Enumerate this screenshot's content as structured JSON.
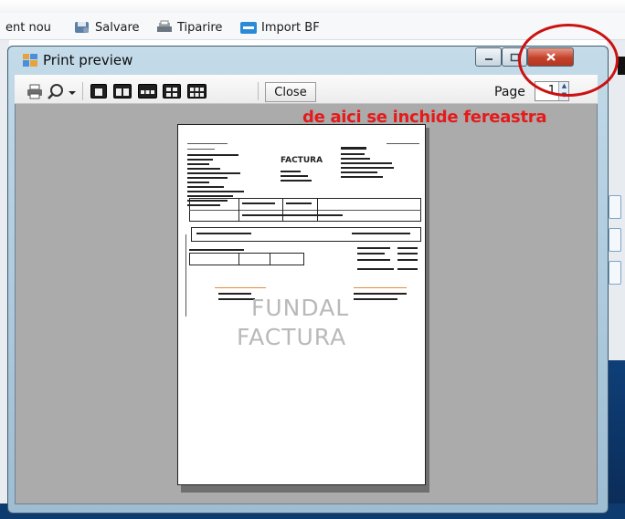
{
  "background_app": {
    "toolbar": [
      {
        "label": "ent nou",
        "icon": "new-document-icon"
      },
      {
        "label": "Salvare",
        "icon": "save-icon"
      },
      {
        "label": "Tiparire",
        "icon": "printer-icon"
      },
      {
        "label": "Import BF",
        "icon": "import-icon"
      }
    ]
  },
  "window": {
    "title": "Print preview",
    "icon": "print-preview-icon",
    "caption_buttons": {
      "minimize": "minimize-icon",
      "maximize": "maximize-icon",
      "close": "close-icon"
    }
  },
  "toolbar": {
    "print_icon": "printer-icon",
    "zoom_icon": "zoom-icon",
    "zoom_dropdown_icon": "chevron-down-icon",
    "page_layout_icons": [
      "one-page-icon",
      "two-pages-icon",
      "three-pages-icon",
      "four-pages-icon",
      "six-pages-icon"
    ],
    "close_label": "Close",
    "page_label": "Page",
    "page_value": "1"
  },
  "annotation": {
    "text": "de aici se inchide fereastra",
    "color": "#e31b1b"
  },
  "document": {
    "heading": "FACTURA",
    "watermark_line1": "FUNDAL",
    "watermark_line2": "FACTURA"
  }
}
